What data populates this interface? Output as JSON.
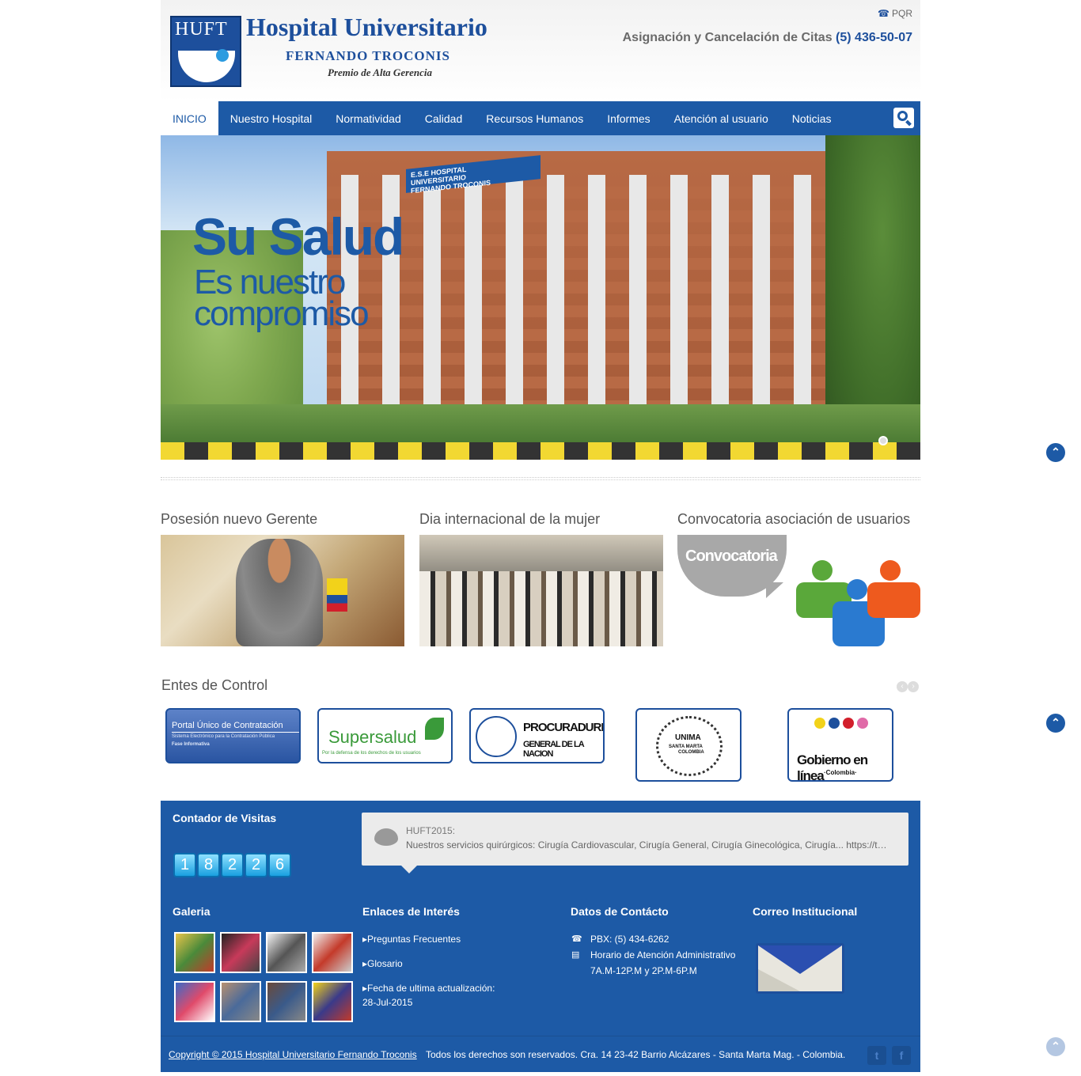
{
  "header": {
    "logo_text": "HUFT",
    "brand_title": "Hospital Universitario",
    "brand_sub": "FERNANDO TROCONIS",
    "brand_award": "Premio de Alta Gerencia",
    "pqr_label": "PQR",
    "citas_label": "Asignación y Cancelación de Citas",
    "citas_phone": "(5) 436-50-07"
  },
  "nav": {
    "items": [
      {
        "label": "INICIO",
        "active": true
      },
      {
        "label": "Nuestro Hospital"
      },
      {
        "label": "Normatividad"
      },
      {
        "label": "Calidad"
      },
      {
        "label": "Recursos Humanos"
      },
      {
        "label": "Informes"
      },
      {
        "label": "Atención al usuario"
      },
      {
        "label": "Noticias"
      }
    ],
    "search_icon": "search-icon"
  },
  "hero": {
    "headline": "Su Salud",
    "tagline_1": "Es nuestro",
    "tagline_2": "compromiso",
    "sign_1": "E.S.E HOSPITAL",
    "sign_2": "UNIVERSITARIO",
    "sign_3": "FERNANDO TROCONIS"
  },
  "news": [
    {
      "title": "Posesión nuevo Gerente"
    },
    {
      "title": "Dia internacional de la mujer"
    },
    {
      "title": "Convocatoria asociación de usuarios",
      "image_text": "Convocatoria"
    }
  ],
  "entes": {
    "title": "Entes de Control",
    "logos": [
      {
        "line1": "Portal Único de Contratación",
        "line2": "Sistema Electrónico para la Contratación Pública",
        "line3": "Fase Informativa"
      },
      {
        "line1": "Supersalud",
        "line2": "Por la defensa de los derechos de los usuarios"
      },
      {
        "line1": "PROCURADURIA",
        "line2": "GENERAL DE LA NACION"
      },
      {
        "line1": "UNIMA",
        "line2": "SANTA MARTA",
        "line3": "COLOMBIA"
      },
      {
        "line1": "Gobierno en línea",
        "line2": "·Colombia·"
      }
    ]
  },
  "footer": {
    "visits_title": "Contador de Visitas",
    "visits_digits": [
      "1",
      "8",
      "2",
      "2",
      "6"
    ],
    "tweet_user": "HUFT2015:",
    "tweet_text": "Nuestros servicios quirúrgicos: Cirugía Cardiovascular, Cirugía General, Cirugía Ginecológica, Cirugía... https://t…",
    "gallery_title": "Galeria",
    "links_title": "Enlaces de Interés",
    "links": [
      "▸Preguntas Frecuentes",
      "▸Glosario",
      "▸Fecha de ultima actualización:"
    ],
    "last_update": "28-Jul-2015",
    "contact_title": "Datos de Contácto",
    "pbx": "PBX: (5) 434-6262",
    "hours_label": "Horario de Atención Administrativo",
    "hours_value": "7A.M-12P.M y 2P.M-6P.M",
    "mail_title": "Correo Institucional",
    "copyright_link": "Copyright © 2015 Hospital Universitario Fernando Troconis",
    "copyright_rest": "Todos los derechos son reservados. Cra. 14 23-42 Barrio Alcázares - Santa Marta Mag. - Colombia.",
    "social": [
      "t",
      "f"
    ]
  },
  "colors": {
    "brand_blue": "#1d5aa6",
    "logo_blue": "#1d4f9c"
  }
}
